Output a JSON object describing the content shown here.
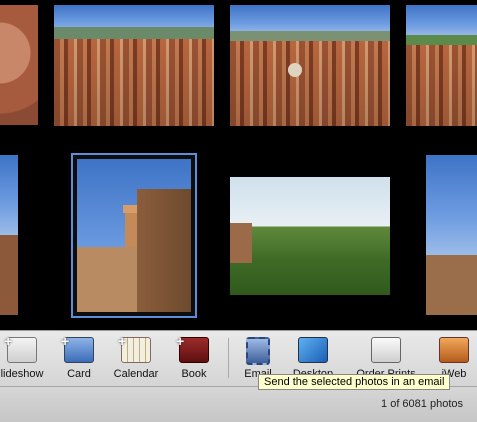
{
  "toolbar": {
    "buttons": [
      {
        "label": "lideshow",
        "icon": "slideshow-icon"
      },
      {
        "label": "Card",
        "icon": "card-icon"
      },
      {
        "label": "Calendar",
        "icon": "calendar-icon"
      },
      {
        "label": "Book",
        "icon": "book-icon"
      },
      {
        "label": "Email",
        "icon": "email-icon"
      },
      {
        "label": "Desktop",
        "icon": "desktop-icon"
      },
      {
        "label": "Order Prints",
        "icon": "order-prints-icon"
      },
      {
        "label": "iWeb",
        "icon": "iweb-icon"
      }
    ]
  },
  "tooltip": {
    "text": "Send the selected photos in an email"
  },
  "status": {
    "photo_count": "1 of 6081 photos"
  },
  "colors": {
    "selection": "#5d8fd8",
    "tooltip_bg": "#ffffcc",
    "toolbar_bg": "#dcdcdc"
  }
}
